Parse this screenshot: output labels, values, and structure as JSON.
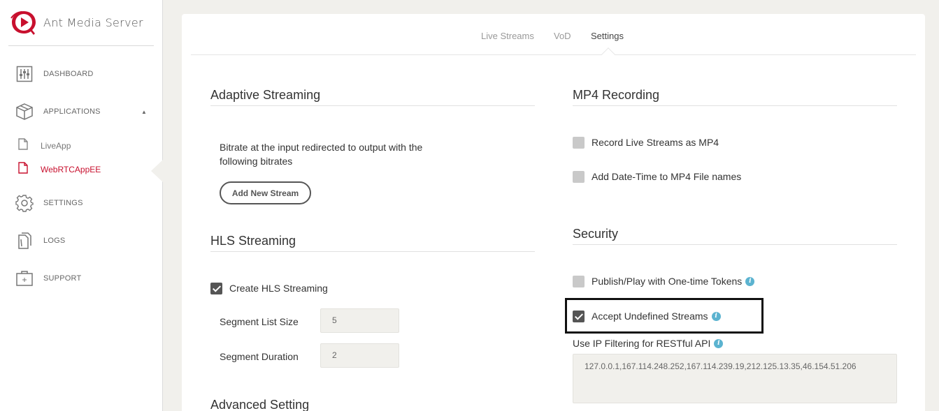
{
  "brand": {
    "name": "Ant Media Server",
    "logo_icon": "ant-media-logo-icon",
    "accent": "#c8102e"
  },
  "sidebar": {
    "items": [
      {
        "label": "DASHBOARD",
        "icon": "sliders-icon"
      },
      {
        "label": "APPLICATIONS",
        "icon": "box-icon",
        "expanded": true
      },
      {
        "label": "SETTINGS",
        "icon": "gear-icon"
      },
      {
        "label": "LOGS",
        "icon": "documents-icon"
      },
      {
        "label": "SUPPORT",
        "icon": "support-box-icon"
      }
    ],
    "apps": [
      {
        "label": "LiveApp",
        "active": false
      },
      {
        "label": "WebRTCAppEE",
        "active": true
      }
    ]
  },
  "tabs": [
    {
      "label": "Live Streams",
      "active": false
    },
    {
      "label": "VoD",
      "active": false
    },
    {
      "label": "Settings",
      "active": true
    }
  ],
  "adaptive": {
    "title": "Adaptive Streaming",
    "description_line1": "Bitrate at the input redirected to output with the",
    "description_line2": "following bitrates",
    "add_button": "Add New Stream"
  },
  "hls": {
    "title": "HLS Streaming",
    "create_label": "Create HLS Streaming",
    "create_checked": true,
    "segment_list_size_label": "Segment List Size",
    "segment_list_size_value": "5",
    "segment_duration_label": "Segment Duration",
    "segment_duration_value": "2"
  },
  "advanced": {
    "title": "Advanced Setting"
  },
  "mp4": {
    "title": "MP4 Recording",
    "record_label": "Record Live Streams as MP4",
    "record_checked": false,
    "datetime_label": "Add Date-Time to MP4 File names",
    "datetime_checked": false
  },
  "security": {
    "title": "Security",
    "tokens_label": "Publish/Play with One-time Tokens",
    "tokens_checked": false,
    "accept_label": "Accept Undefined Streams",
    "accept_checked": true,
    "ip_filter_label": "Use IP Filtering for RESTful API",
    "ip_filter_value": "127.0.0.1,167.114.248.252,167.114.239.19,212.125.13.35,46.154.51.206"
  }
}
